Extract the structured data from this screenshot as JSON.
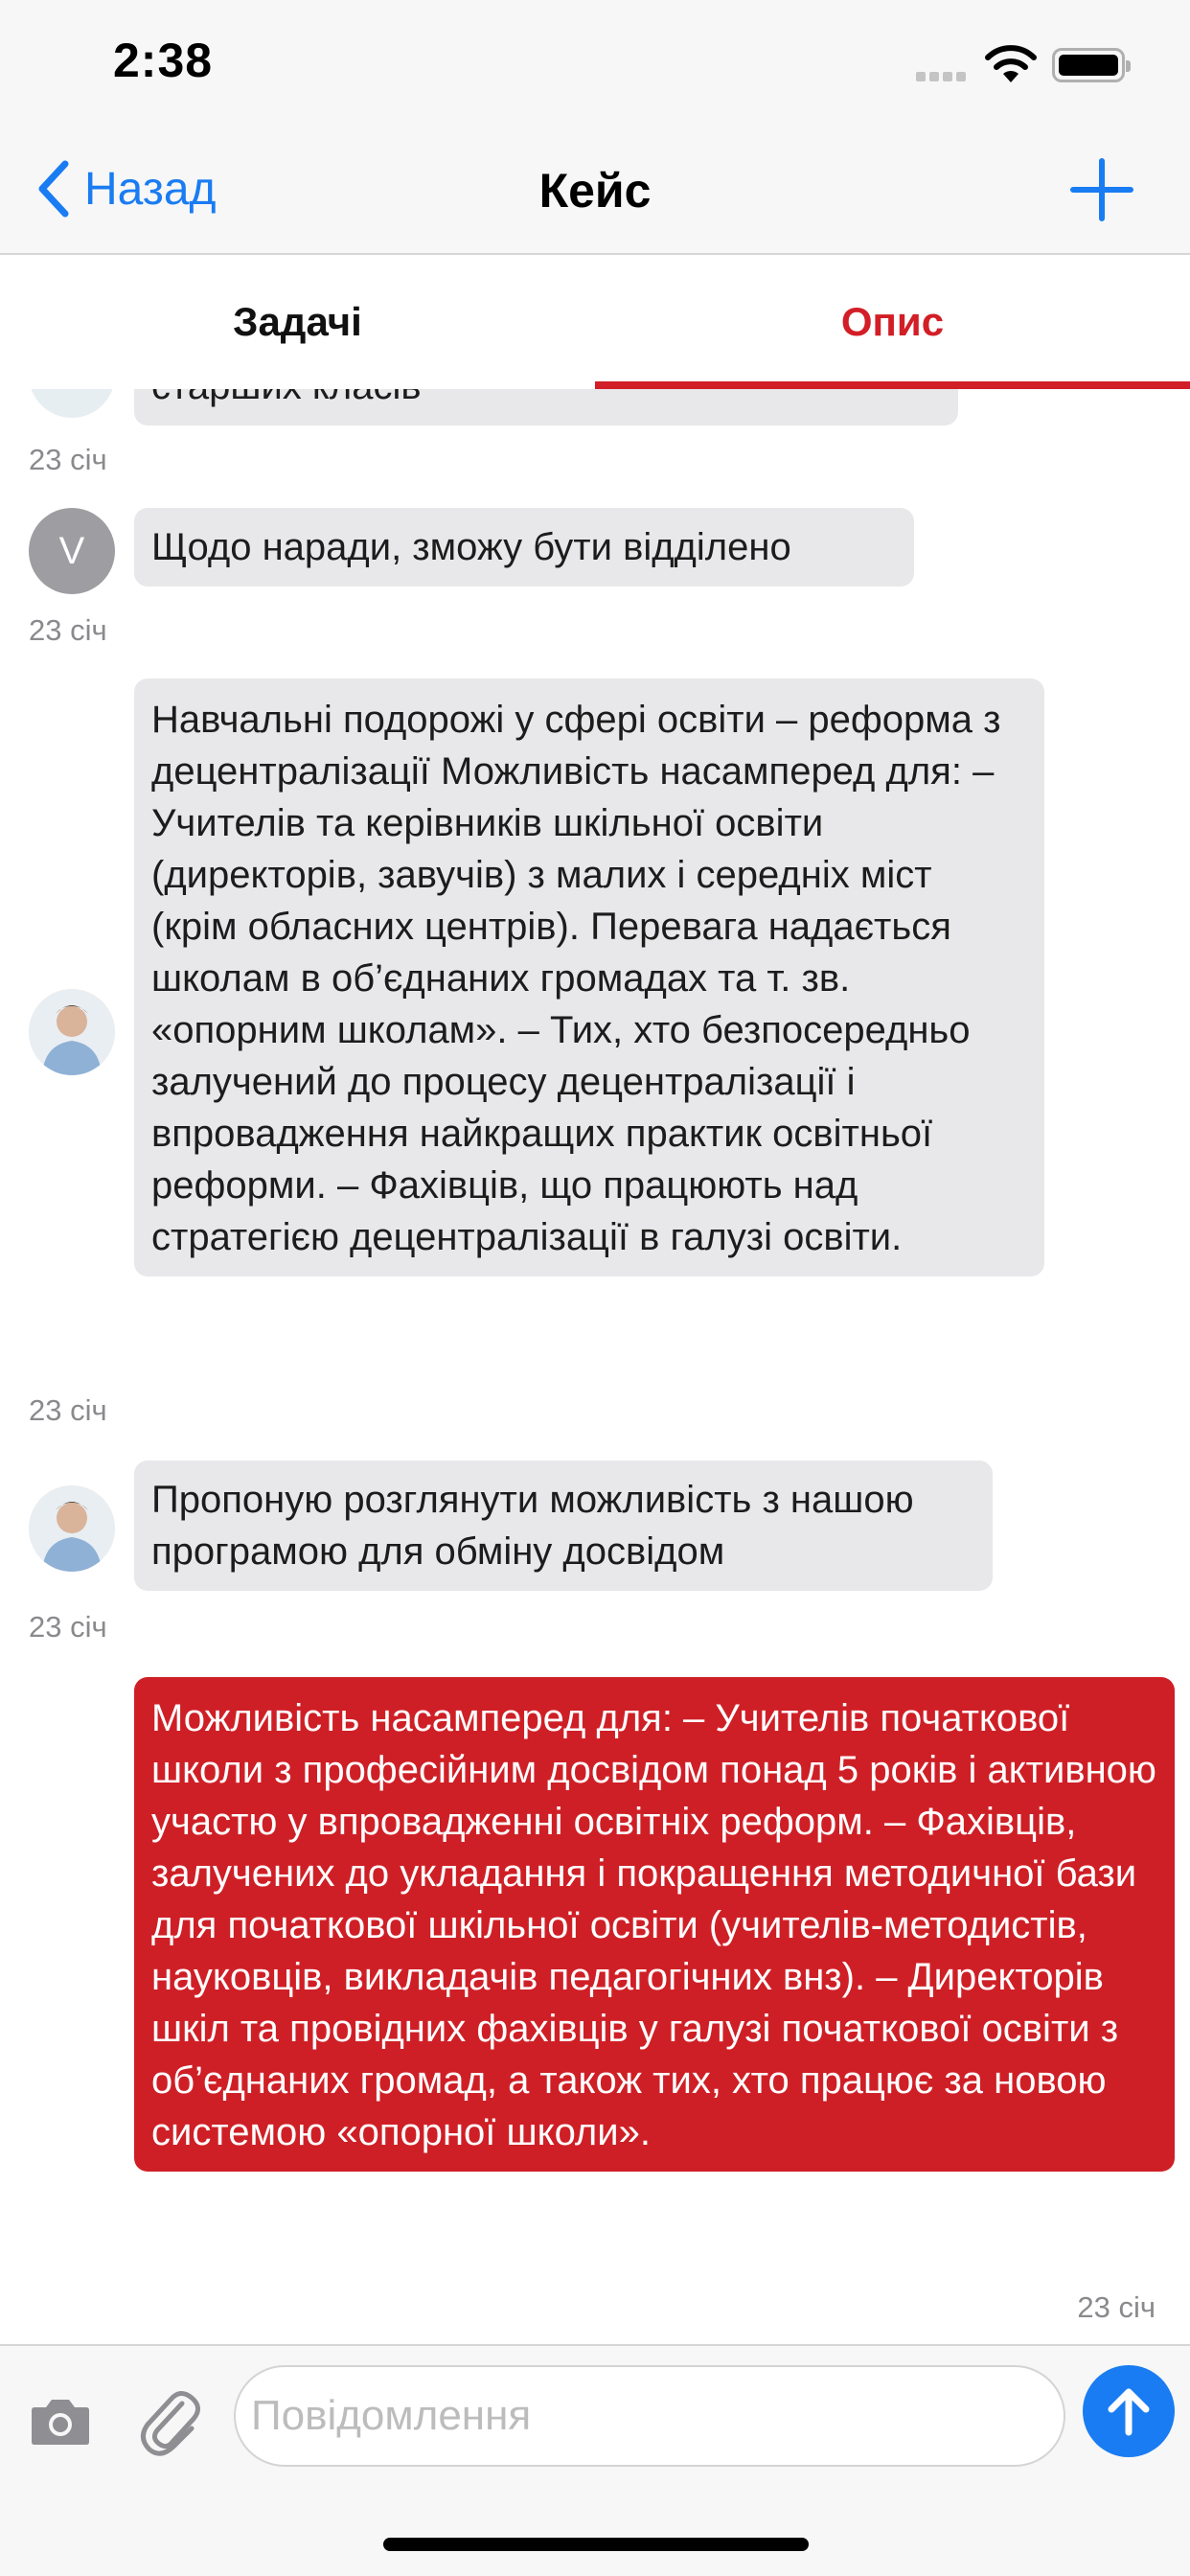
{
  "status_bar": {
    "time": "2:38"
  },
  "nav": {
    "back_label": "Назад",
    "title": "Кейс"
  },
  "tabs": [
    {
      "label": "Задачі",
      "active": false
    },
    {
      "label": "Опис",
      "active": true
    }
  ],
  "messages": [
    {
      "text": "старших класів",
      "timestamp": "23 січ",
      "direction": "in"
    },
    {
      "text": "Щодо наради, зможу бути відділено",
      "avatar_letter": "V",
      "timestamp": "23 січ",
      "direction": "in"
    },
    {
      "text": "Навчальні подорожі у сфері освіти – реформа з децентралізації Можливість насамперед для: – Учителів та керівників шкільної освіти (директорів, завучів) з малих і середніх міст (крім обласних центрів). Перевага надається школам в об’єднаних громадах та т. зв. «опорним школам». – Тих, хто безпосередньо залучений до процесу децентралізації і впровадження найкращих практик освітньої реформи. – Фахівців, що працюють над стратегією децентралізації в галузі освіти.",
      "timestamp": "23 січ",
      "direction": "in"
    },
    {
      "text": "Пропоную розглянути можливість з нашою програмою для обміну досвідом",
      "timestamp": "23 січ",
      "direction": "in"
    },
    {
      "text": "Можливість насамперед для: – Учителів початкової школи з професійним досвідом понад 5 років і активною участю у впровадженні освітніх реформ. – Фахівців, залучених до укладання і покращення методичної бази для початкової шкільної освіти (учителів-методистів, науковців, викладачів педагогічних внз). – Директорів шкіл та провідних фахівців у галузі початкової освіти з об’єднаних громад, а також тих, хто працює за новою системою «опорної школи».",
      "timestamp": "23 січ",
      "direction": "out"
    }
  ],
  "composer": {
    "placeholder": "Повідомлення"
  },
  "colors": {
    "accent_blue": "#1a7cf2",
    "accent_red": "#cf1f26",
    "bubble_in": "#e8e8ea"
  }
}
